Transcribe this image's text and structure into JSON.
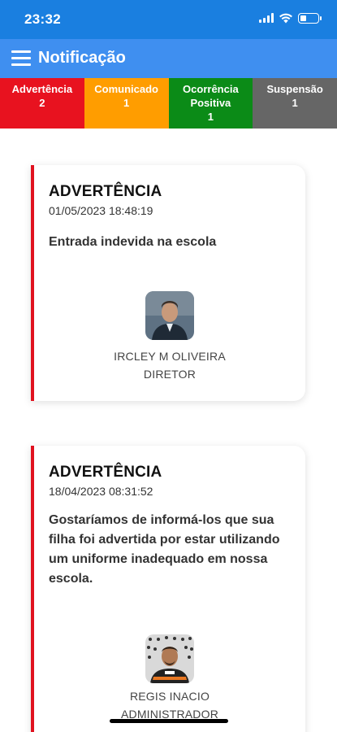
{
  "status_bar": {
    "time": "23:32"
  },
  "app_bar": {
    "title": "Notificação"
  },
  "tabs": [
    {
      "label": "Advertência",
      "count": "2",
      "color": "#e8121f"
    },
    {
      "label": "Comunicado",
      "count": "1",
      "color": "#ff9d00"
    },
    {
      "label": "Ocorrência Positiva",
      "count": "1",
      "color": "#0b8b17"
    },
    {
      "label": "Suspensão",
      "count": "1",
      "color": "#666666"
    }
  ],
  "notifications": [
    {
      "type": "ADVERTÊNCIA",
      "date": "01/05/2023 18:48:19",
      "message": "Entrada indevida na escola",
      "author_name": "IRCLEY M OLIVEIRA",
      "author_role": "DIRETOR",
      "avatar": "user-photo"
    },
    {
      "type": "ADVERTÊNCIA",
      "date": "18/04/2023 08:31:52",
      "message": "Gostaríamos de informá-los que sua filha foi advertida por estar utilizando um uniforme inadequado em nossa escola.",
      "author_name": "REGIS INACIO",
      "author_role": "ADMINISTRADOR",
      "avatar": "user-photo"
    }
  ],
  "colors": {
    "status_bar": "#1a7fe0",
    "app_bar": "#3f8ff0",
    "card_accent": "#e0121f"
  },
  "icons": [
    "menu-icon",
    "signal-icon",
    "wifi-icon",
    "battery-icon"
  ]
}
